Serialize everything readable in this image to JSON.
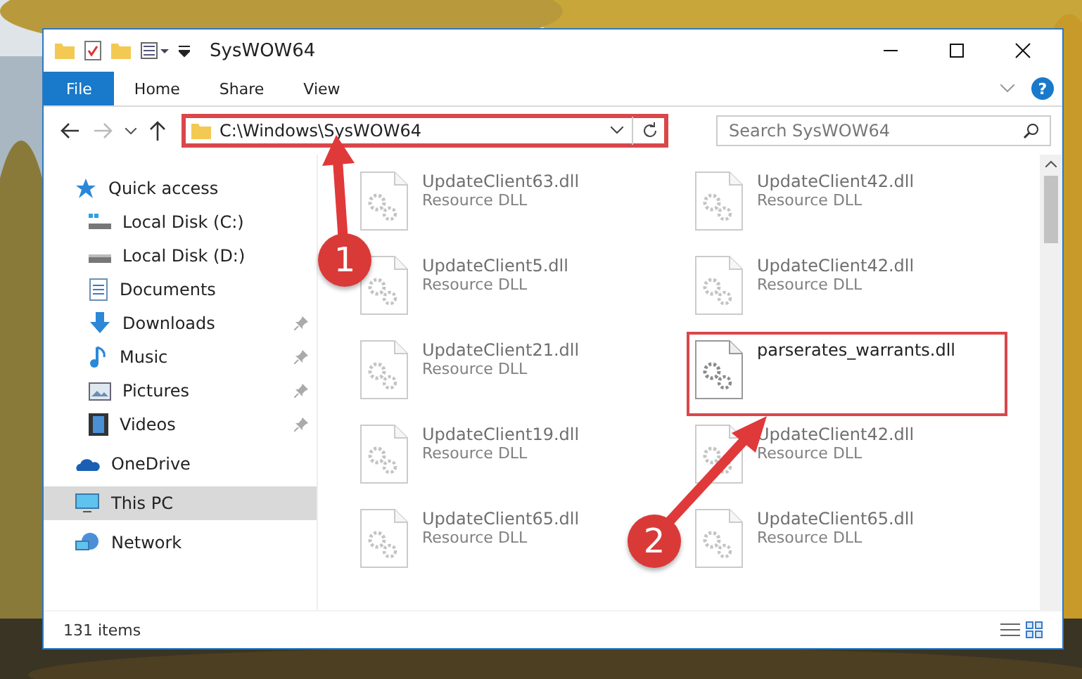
{
  "window": {
    "title": "SysWOW64"
  },
  "ribbon_tabs": [
    {
      "label": "File",
      "selected": true
    },
    {
      "label": "Home",
      "selected": false
    },
    {
      "label": "Share",
      "selected": false
    },
    {
      "label": "View",
      "selected": false
    }
  ],
  "help_button": "?",
  "address_bar": {
    "value": "C:\\Windows\\SysWOW64",
    "highlighted": true
  },
  "search": {
    "placeholder": "Search SysWOW64"
  },
  "sidebar": {
    "items": [
      {
        "label": "Quick access",
        "selected": false,
        "children": [
          {
            "label": "Local Disk (C:)",
            "selected": false,
            "pinned": false
          },
          {
            "label": "Local Disk (D:)",
            "selected": false,
            "pinned": false
          },
          {
            "label": "Documents",
            "selected": false,
            "pinned": false
          },
          {
            "label": "Downloads",
            "selected": false,
            "pinned": true
          },
          {
            "label": "Music",
            "selected": false,
            "pinned": true
          },
          {
            "label": "Pictures",
            "selected": false,
            "pinned": true
          },
          {
            "label": "Videos",
            "selected": false,
            "pinned": true
          }
        ]
      },
      {
        "label": "OneDrive",
        "selected": false
      },
      {
        "label": "This PC",
        "selected": true
      },
      {
        "label": "Network",
        "selected": false
      }
    ]
  },
  "files": [
    {
      "name": "UpdateClient63.dll",
      "type": "Resource DLL",
      "kind": "dimmed"
    },
    {
      "name": "UpdateClient42.dll",
      "type": "Resource DLL",
      "kind": "dimmed"
    },
    {
      "name": "UpdateClient5.dll",
      "type": "Resource DLL",
      "kind": "dimmed"
    },
    {
      "name": "UpdateClient42.dll",
      "type": "Resource DLL",
      "kind": "dimmed"
    },
    {
      "name": "UpdateClient21.dll",
      "type": "Resource DLL",
      "kind": "dimmed"
    },
    {
      "name": "parserates_warrants.dll",
      "kind": "highlighted"
    },
    {
      "name": "UpdateClient19.dll",
      "type": "Resource DLL",
      "kind": "dimmed"
    },
    {
      "name": "UpdateClient42.dll",
      "type": "Resource DLL",
      "kind": "dimmed"
    },
    {
      "name": "UpdateClient65.dll",
      "type": "Resource DLL",
      "kind": "dimmed"
    },
    {
      "name": "UpdateClient65.dll",
      "type": "Resource DLL",
      "kind": "dimmed"
    }
  ],
  "status_bar": {
    "count": "131 items"
  },
  "callouts": [
    "1",
    "2"
  ]
}
